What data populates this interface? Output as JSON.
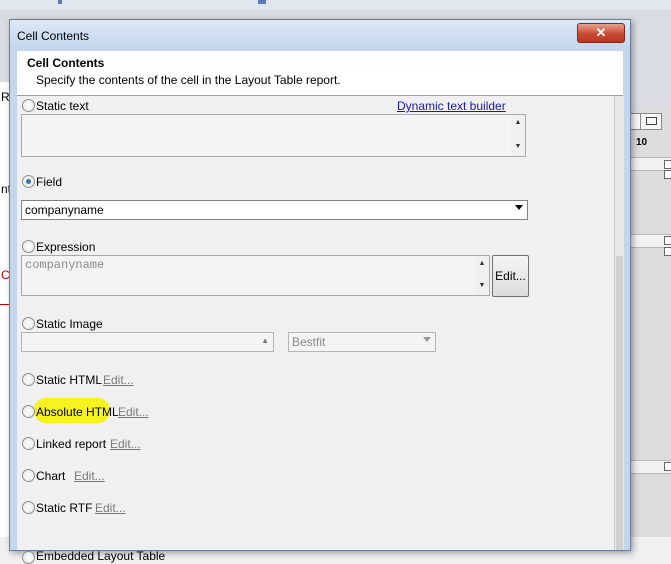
{
  "background": {
    "left_fragments": [
      "Re",
      "nt",
      "C"
    ],
    "right_page_number": "10"
  },
  "dialog": {
    "title": "Cell Contents",
    "close_glyph": "✕",
    "header": {
      "title": "Cell Contents",
      "subtitle": "Specify the contents of the cell in the Layout Table report."
    }
  },
  "options": {
    "static_text": {
      "label": "Static text",
      "link": "Dynamic text builder",
      "value": ""
    },
    "field": {
      "label": "Field",
      "selected": "companyname"
    },
    "expression": {
      "label": "Expression",
      "value": "companyname",
      "edit_button": "Edit..."
    },
    "static_image": {
      "label": "Static Image",
      "value": "",
      "fit": "Bestfit"
    },
    "static_html": {
      "label": "Static HTML",
      "edit": "Edit..."
    },
    "absolute_html": {
      "label": "Absolute HTML",
      "edit": "Edit..."
    },
    "linked_report": {
      "label": "Linked report",
      "edit": "Edit..."
    },
    "chart": {
      "label": "Chart",
      "edit": "Edit..."
    },
    "static_rtf": {
      "label": "Static RTF",
      "edit": "Edit..."
    },
    "embedded_layout_table": {
      "label": "Embedded Layout Table"
    }
  },
  "colors": {
    "highlight": "#f5f21e",
    "link": "#1a1aa8",
    "radio_selected": "#3c6fb5"
  }
}
